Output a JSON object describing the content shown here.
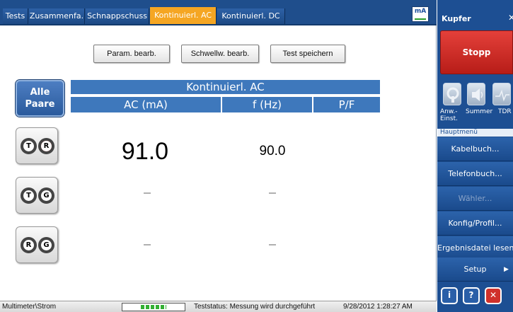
{
  "tabs": [
    {
      "label": "Tests",
      "active": false
    },
    {
      "label": "Zusammenfa.",
      "active": false
    },
    {
      "label": "Schnappschuss",
      "active": false
    },
    {
      "label": "Kontinuierl. AC",
      "active": true
    },
    {
      "label": "Kontinuierl. DC",
      "active": false
    }
  ],
  "unit_icon": {
    "label": "mA",
    "icon": "ammeter-icon"
  },
  "toolbar": {
    "param_label": "Param. bearb.",
    "threshold_label": "Schwellw. bearb.",
    "save_label": "Test speichern"
  },
  "all_pairs": {
    "line1": "Alle",
    "line2": "Paare"
  },
  "table": {
    "title": "Kontinuierl. AC",
    "columns": [
      "AC (mA)",
      "f (Hz)",
      "P/F"
    ],
    "rows": [
      {
        "pair": [
          "T",
          "R"
        ],
        "ac": "91.0",
        "f": "90.0",
        "pf": ""
      },
      {
        "pair": [
          "T",
          "G"
        ],
        "ac": "",
        "f": "",
        "pf": ""
      },
      {
        "pair": [
          "R",
          "G"
        ],
        "ac": "",
        "f": "",
        "pf": ""
      }
    ]
  },
  "status": {
    "path": "Multimeter\\Strom",
    "battery_icon": "battery-icon",
    "battery_level": 0.45,
    "message": "Teststatus: Messung wird durchgeführt",
    "datetime": "9/28/2012 1:28:27 AM"
  },
  "side": {
    "title": "Kupfer",
    "stop_label": "Stopp",
    "tools": [
      {
        "line1": "Anw.-",
        "line2": "Einst.",
        "icon": "wrench-icon"
      },
      {
        "line1": "Summer",
        "line2": "",
        "icon": "speaker-icon"
      },
      {
        "line1": "TDR",
        "line2": "",
        "icon": "waveform-icon"
      }
    ],
    "main_menu_title": "Hauptmenü",
    "menu": [
      {
        "label": "Kabelbuch...",
        "enabled": true
      },
      {
        "label": "Telefonbuch...",
        "enabled": true
      },
      {
        "label": "Wähler...",
        "enabled": false
      },
      {
        "label": "Konfig/Profil...",
        "enabled": true
      },
      {
        "label": "Ergebnisdatei lesen",
        "enabled": true
      },
      {
        "label": "Setup",
        "enabled": true
      }
    ],
    "bottom_icons": [
      "info-icon",
      "help-icon",
      "close-icon"
    ],
    "colors": {
      "panel": "#1d4f93",
      "stop": "#d0312b",
      "active_tab": "#f5a623"
    }
  }
}
